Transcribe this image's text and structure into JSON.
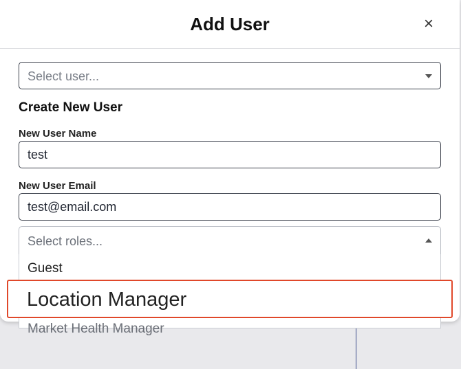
{
  "modal": {
    "title": "Add User",
    "close_symbol": "×"
  },
  "user_select": {
    "placeholder": "Select user..."
  },
  "create_section": {
    "title": "Create New User",
    "name_label": "New User Name",
    "name_value": "test",
    "email_label": "New User Email",
    "email_value": "test@email.com"
  },
  "roles": {
    "placeholder": "Select roles...",
    "options": [
      "Guest",
      "Location Manager",
      "Market Health Manager"
    ],
    "highlighted": "Location Manager"
  },
  "colors": {
    "highlight": "#e0482a"
  }
}
